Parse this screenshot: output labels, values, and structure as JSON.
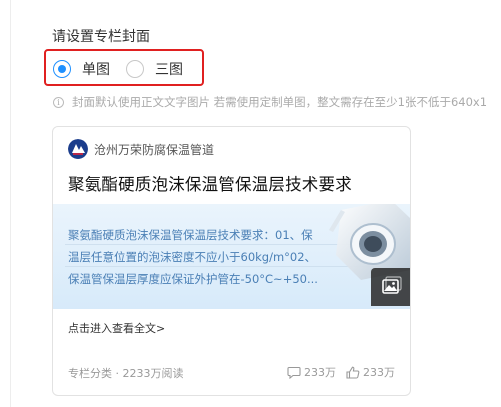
{
  "section_title": "请设置专栏封面",
  "cover_mode": {
    "options": [
      {
        "label": "单图",
        "selected": true
      },
      {
        "label": "三图",
        "selected": false
      }
    ],
    "highlight_color": "#e02020",
    "accent_color": "#1e90ff"
  },
  "hint": {
    "icon": "info-icon",
    "text": "封面默认使用正文文字图片 若需使用定制单图，整文需存在至少1张不低于640x1"
  },
  "preview_card": {
    "account_name": "沧州万荣防腐保温管道",
    "title": "聚氨酯硬质泡沫保温管保温层技术要求",
    "cover_lines": [
      "聚氨酯硬质泡沫保温管保温层技术要求：01、保",
      "温层任意位置的泡沫密度不应小于60kg/m°02、",
      "保温管保温层厚度应保证外护管在-50°C~+50..."
    ],
    "read_more": "点击进入查看全文>",
    "meta": "专栏分类 · 2233万阅读",
    "comments": "233万",
    "likes": "233万"
  }
}
